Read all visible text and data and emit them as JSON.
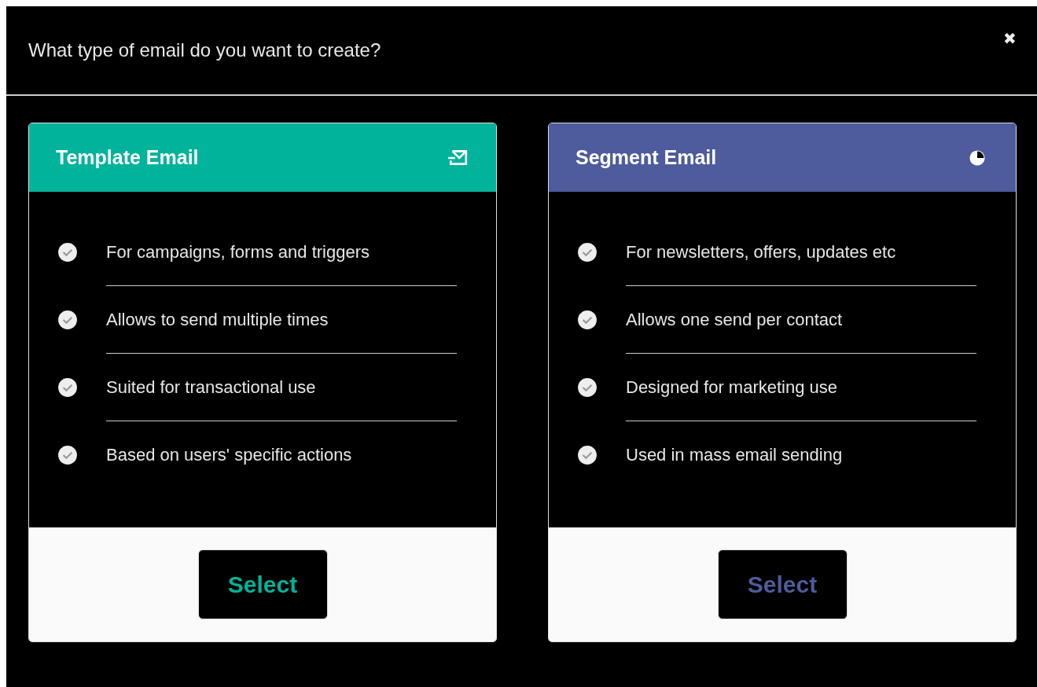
{
  "dialog": {
    "title": "What type of email do you want to create?",
    "close": "✖"
  },
  "cards": [
    {
      "kind": "template",
      "title": "Template Email",
      "color": "#00b39a",
      "features": [
        "For campaigns, forms and triggers",
        "Allows to send multiple times",
        "Suited for transactional use",
        "Based on users' specific actions"
      ],
      "button": "Select"
    },
    {
      "kind": "segment",
      "title": "Segment Email",
      "color": "#4e5b9c",
      "features": [
        "For newsletters, offers, updates etc",
        "Allows one send per contact",
        "Designed for marketing use",
        "Used in mass email sending"
      ],
      "button": "Select"
    }
  ]
}
